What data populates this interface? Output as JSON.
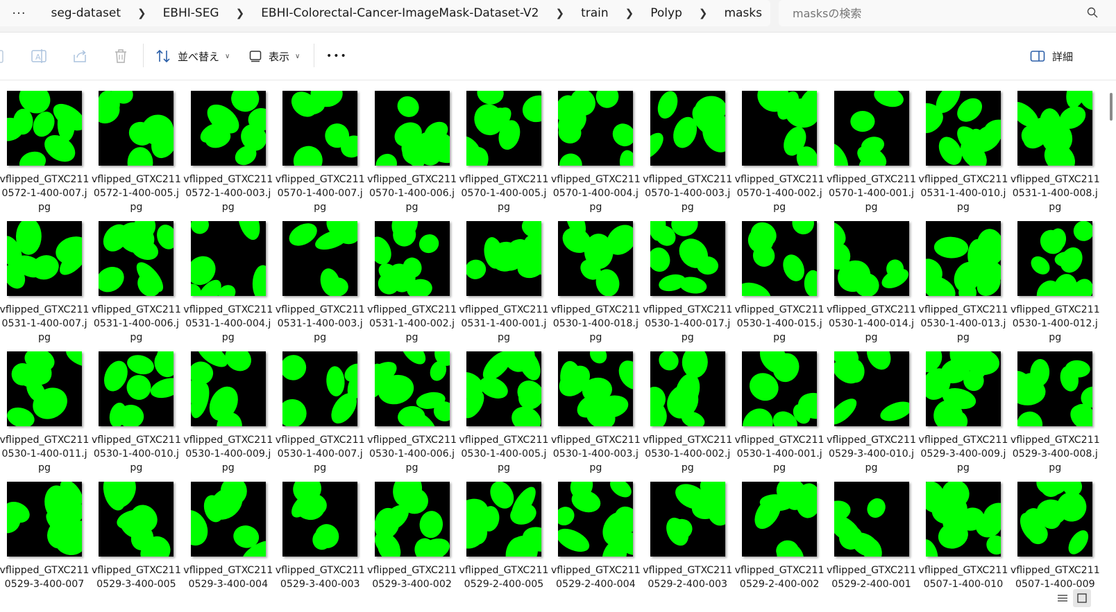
{
  "breadcrumb": {
    "overflow_label": "···",
    "items": [
      "seg-dataset",
      "EBHI-SEG",
      "EBHI-Colorectal-Cancer-ImageMask-Dataset-V2",
      "train",
      "Polyp",
      "masks"
    ]
  },
  "search": {
    "placeholder": "masksの検索"
  },
  "toolbar": {
    "sort_label": "並べ替え",
    "view_label": "表示",
    "more_label": "•••",
    "details_label": "詳細"
  },
  "colors": {
    "mask_fill": "#00ff00",
    "mask_bg": "#000000"
  },
  "files": [
    "vflipped_GTXC2110572-1-400-007.jpg",
    "vflipped_GTXC2110572-1-400-005.jpg",
    "vflipped_GTXC2110572-1-400-003.jpg",
    "vflipped_GTXC2110570-1-400-007.jpg",
    "vflipped_GTXC2110570-1-400-006.jpg",
    "vflipped_GTXC2110570-1-400-005.jpg",
    "vflipped_GTXC2110570-1-400-004.jpg",
    "vflipped_GTXC2110570-1-400-003.jpg",
    "vflipped_GTXC2110570-1-400-002.jpg",
    "vflipped_GTXC2110570-1-400-001.jpg",
    "vflipped_GTXC2110531-1-400-010.jpg",
    "vflipped_GTXC2110531-1-400-008.jpg",
    "vflipped_GTXC2110531-1-400-007.jpg",
    "vflipped_GTXC2110531-1-400-006.jpg",
    "vflipped_GTXC2110531-1-400-004.jpg",
    "vflipped_GTXC2110531-1-400-003.jpg",
    "vflipped_GTXC2110531-1-400-002.jpg",
    "vflipped_GTXC2110531-1-400-001.jpg",
    "vflipped_GTXC2110530-1-400-018.jpg",
    "vflipped_GTXC2110530-1-400-017.jpg",
    "vflipped_GTXC2110530-1-400-015.jpg",
    "vflipped_GTXC2110530-1-400-014.jpg",
    "vflipped_GTXC2110530-1-400-013.jpg",
    "vflipped_GTXC2110530-1-400-012.jpg",
    "vflipped_GTXC2110530-1-400-011.jpg",
    "vflipped_GTXC2110530-1-400-010.jpg",
    "vflipped_GTXC2110530-1-400-009.jpg",
    "vflipped_GTXC2110530-1-400-007.jpg",
    "vflipped_GTXC2110530-1-400-006.jpg",
    "vflipped_GTXC2110530-1-400-005.jpg",
    "vflipped_GTXC2110530-1-400-003.jpg",
    "vflipped_GTXC2110530-1-400-002.jpg",
    "vflipped_GTXC2110530-1-400-001.jpg",
    "vflipped_GTXC2110529-3-400-010.jpg",
    "vflipped_GTXC2110529-3-400-009.jpg",
    "vflipped_GTXC2110529-3-400-008.jpg",
    "vflipped_GTXC2110529-3-400-007",
    "vflipped_GTXC2110529-3-400-005",
    "vflipped_GTXC2110529-3-400-004",
    "vflipped_GTXC2110529-3-400-003",
    "vflipped_GTXC2110529-3-400-002",
    "vflipped_GTXC2110529-2-400-005",
    "vflipped_GTXC2110529-2-400-004",
    "vflipped_GTXC2110529-2-400-003",
    "vflipped_GTXC2110529-2-400-002",
    "vflipped_GTXC2110529-2-400-001",
    "vflipped_GTXC2110507-1-400-010",
    "vflipped_GTXC2110507-1-400-009"
  ]
}
